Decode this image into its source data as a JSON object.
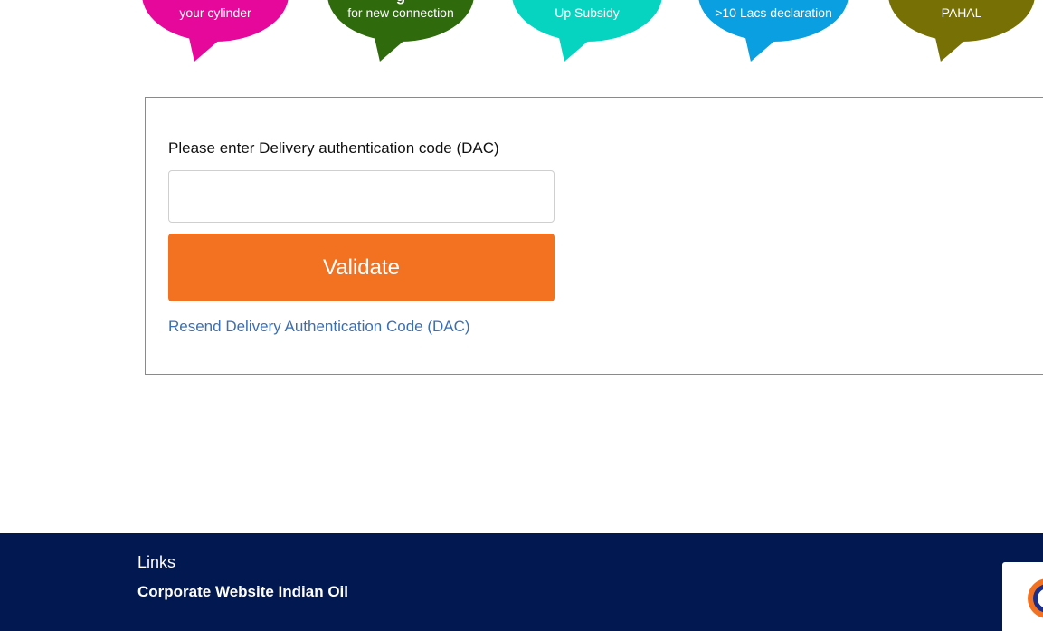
{
  "bubbles": [
    {
      "title": "",
      "subtitle": "your cylinder",
      "color": "#e6089a"
    },
    {
      "title": "g",
      "subtitle": "for new connection",
      "color": "#2f6b0d"
    },
    {
      "title": "",
      "subtitle": "Up Subsidy",
      "color": "#07d4c0"
    },
    {
      "title": "",
      "subtitle": ">10 Lacs declaration",
      "color": "#0a9fe0"
    },
    {
      "title": "",
      "subtitle": "PAHAL",
      "color": "#767005"
    }
  ],
  "form": {
    "label": "Please enter Delivery authentication code (DAC)",
    "input_value": "",
    "input_placeholder": "",
    "validate_label": "Validate",
    "resend_label": "Resend Delivery Authentication Code (DAC)"
  },
  "colors": {
    "accent_button": "#f27221",
    "link": "#3b6fb4",
    "footer_bg": "#021850"
  },
  "footer": {
    "heading": "Links",
    "link": "Corporate Website Indian Oil",
    "logo_icon": "indian-oil-logo-icon"
  }
}
